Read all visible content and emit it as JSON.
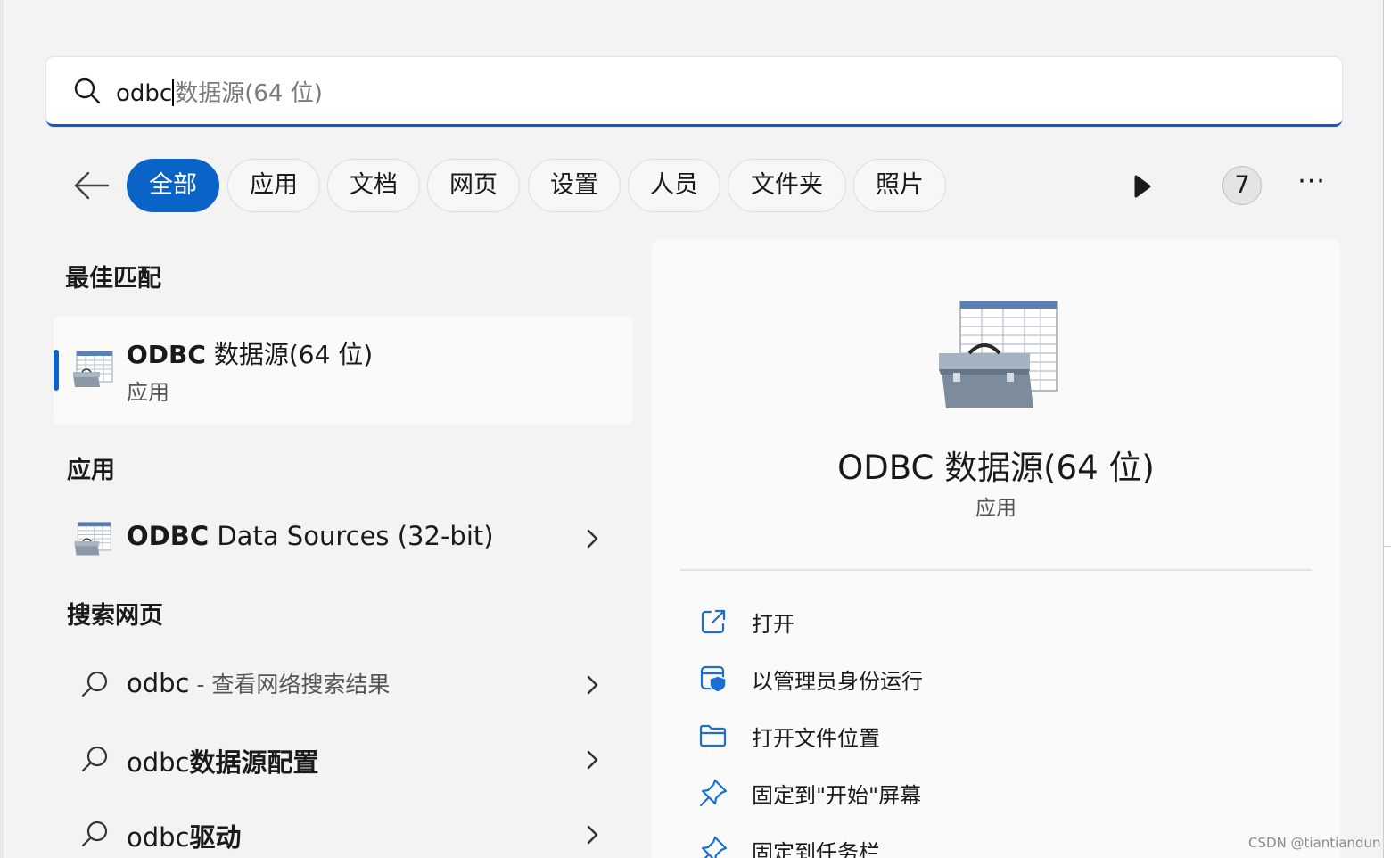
{
  "search": {
    "typed_text": "odbc",
    "suggestion_text": "数据源(64 位)"
  },
  "tabs": [
    {
      "label": "全部",
      "active": true
    },
    {
      "label": "应用",
      "active": false
    },
    {
      "label": "文档",
      "active": false
    },
    {
      "label": "网页",
      "active": false
    },
    {
      "label": "设置",
      "active": false
    },
    {
      "label": "人员",
      "active": false
    },
    {
      "label": "文件夹",
      "active": false
    },
    {
      "label": "照片",
      "active": false
    }
  ],
  "badge_count": "7",
  "more_label": "···",
  "sections": {
    "best_match": "最佳匹配",
    "apps": "应用",
    "web": "搜索网页"
  },
  "best_match": {
    "title_bold": "ODBC",
    "title_rest": " 数据源(64 位)",
    "subtitle": "应用"
  },
  "apps": [
    {
      "title_bold": "ODBC",
      "title_rest": " Data Sources (32-bit)"
    }
  ],
  "web_results": [
    {
      "query": "odbc",
      "query_bold": "",
      "hint": " - 查看网络搜索结果"
    },
    {
      "query": "odbc",
      "query_bold": "数据源配置",
      "hint": ""
    },
    {
      "query": "odbc",
      "query_bold": "驱动",
      "hint": ""
    }
  ],
  "detail": {
    "title": "ODBC 数据源(64 位)",
    "type": "应用",
    "actions": [
      {
        "label": "打开",
        "icon": "open-external-icon"
      },
      {
        "label": "以管理员身份运行",
        "icon": "admin-shield-icon"
      },
      {
        "label": "打开文件位置",
        "icon": "folder-icon"
      },
      {
        "label": "固定到\"开始\"屏幕",
        "icon": "pin-icon"
      },
      {
        "label": "固定到任务栏",
        "icon": "pin-icon"
      }
    ]
  },
  "watermark": "CSDN @tiantiandun",
  "colors": {
    "accent": "#0a63c6",
    "panel_bg": "#f3f3f3",
    "card_bg": "#fafafa",
    "icon_blue": "#1a6fd1"
  }
}
